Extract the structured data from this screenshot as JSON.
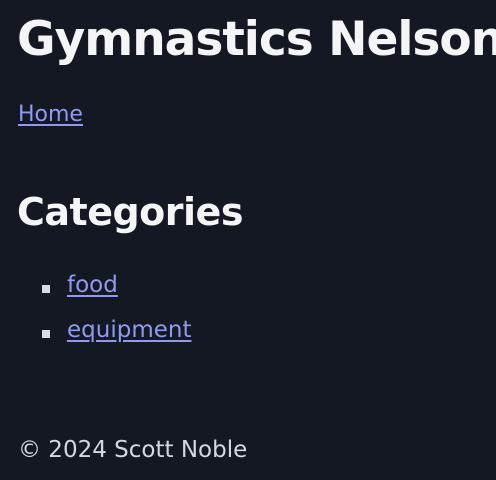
{
  "site": {
    "title": "Gymnastics Nelson"
  },
  "nav": {
    "home_label": "Home"
  },
  "categories": {
    "heading": "Categories",
    "items": [
      {
        "label": "food"
      },
      {
        "label": "equipment"
      }
    ]
  },
  "footer": {
    "text": "© 2024 Scott Noble"
  },
  "colors": {
    "background": "#131823",
    "link": "#8f9af0",
    "heading": "#f4f5f7"
  }
}
